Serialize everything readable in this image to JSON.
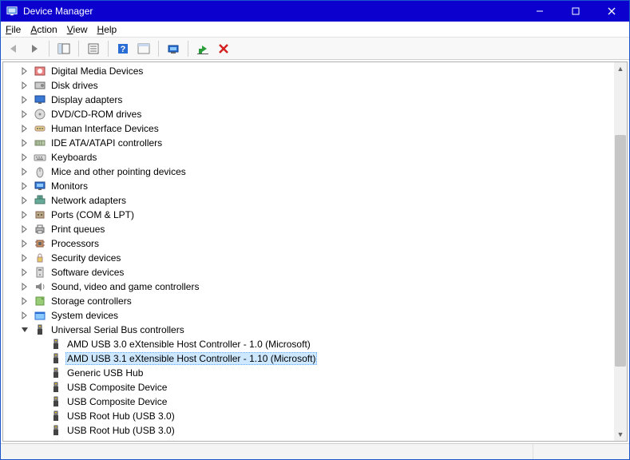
{
  "window": {
    "title": "Device Manager"
  },
  "menu": {
    "file": "File",
    "action": "Action",
    "view": "View",
    "help": "Help"
  },
  "tree": {
    "categories": [
      {
        "label": "Digital Media Devices",
        "icon": "media"
      },
      {
        "label": "Disk drives",
        "icon": "disk"
      },
      {
        "label": "Display adapters",
        "icon": "display"
      },
      {
        "label": "DVD/CD-ROM drives",
        "icon": "dvd"
      },
      {
        "label": "Human Interface Devices",
        "icon": "hid"
      },
      {
        "label": "IDE ATA/ATAPI controllers",
        "icon": "ide"
      },
      {
        "label": "Keyboards",
        "icon": "keyboard"
      },
      {
        "label": "Mice and other pointing devices",
        "icon": "mouse"
      },
      {
        "label": "Monitors",
        "icon": "monitor"
      },
      {
        "label": "Network adapters",
        "icon": "network"
      },
      {
        "label": "Ports (COM & LPT)",
        "icon": "port"
      },
      {
        "label": "Print queues",
        "icon": "printer"
      },
      {
        "label": "Processors",
        "icon": "cpu"
      },
      {
        "label": "Security devices",
        "icon": "security"
      },
      {
        "label": "Software devices",
        "icon": "software"
      },
      {
        "label": "Sound, video and game controllers",
        "icon": "sound"
      },
      {
        "label": "Storage controllers",
        "icon": "storage"
      },
      {
        "label": "System devices",
        "icon": "system"
      }
    ],
    "usb": {
      "label": "Universal Serial Bus controllers",
      "children": [
        {
          "label": "AMD USB 3.0 eXtensible Host Controller - 1.0 (Microsoft)",
          "selected": false
        },
        {
          "label": "AMD USB 3.1 eXtensible Host Controller - 1.10 (Microsoft)",
          "selected": true
        },
        {
          "label": "Generic USB Hub",
          "selected": false
        },
        {
          "label": "USB Composite Device",
          "selected": false
        },
        {
          "label": "USB Composite Device",
          "selected": false
        },
        {
          "label": "USB Root Hub (USB 3.0)",
          "selected": false
        },
        {
          "label": "USB Root Hub (USB 3.0)",
          "selected": false
        }
      ]
    }
  }
}
